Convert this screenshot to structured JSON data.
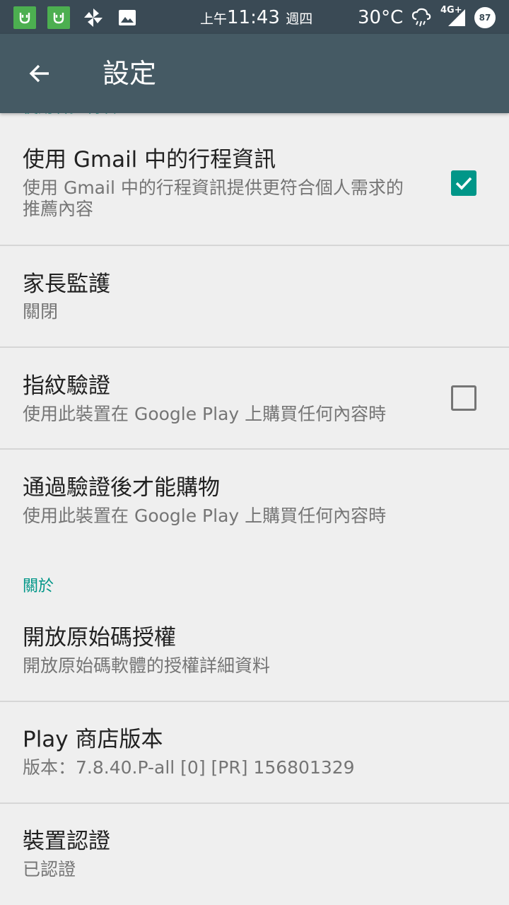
{
  "status_bar": {
    "time_prefix": "上午",
    "time": "11:43",
    "weekday": "週四",
    "temperature": "30°C",
    "network": "4G+",
    "battery": "87",
    "icons": [
      "mi-app-icon",
      "mi-app-icon",
      "pinwheel-icon",
      "image-icon",
      "weather-icon",
      "signal-icon",
      "battery-icon"
    ]
  },
  "toolbar": {
    "back_icon": "arrow-back-icon",
    "title": "設定"
  },
  "colors": {
    "status_bar": "#3a4a55",
    "toolbar": "#455a64",
    "accent": "#009688",
    "background": "#efefef"
  },
  "cut_section_header": "使用者控制項",
  "items": [
    {
      "title": "使用 Gmail 中的行程資訊",
      "subtitle": "使用 Gmail 中的行程資訊提供更符合個人需求的推薦內容",
      "checkbox": true
    },
    {
      "title": "家長監護",
      "subtitle": "關閉"
    },
    {
      "title": "指紋驗證",
      "subtitle": "使用此裝置在 Google Play 上購買任何內容時",
      "checkbox": false
    },
    {
      "title": "通過驗證後才能購物",
      "subtitle": "使用此裝置在 Google Play 上購買任何內容時"
    }
  ],
  "about": {
    "header": "關於",
    "items": [
      {
        "title": "開放原始碼授權",
        "subtitle": "開放原始碼軟體的授權詳細資料"
      },
      {
        "title": "Play 商店版本",
        "subtitle": "版本：7.8.40.P-all [0] [PR] 156801329"
      },
      {
        "title": "裝置認證",
        "subtitle": "已認證"
      }
    ]
  }
}
